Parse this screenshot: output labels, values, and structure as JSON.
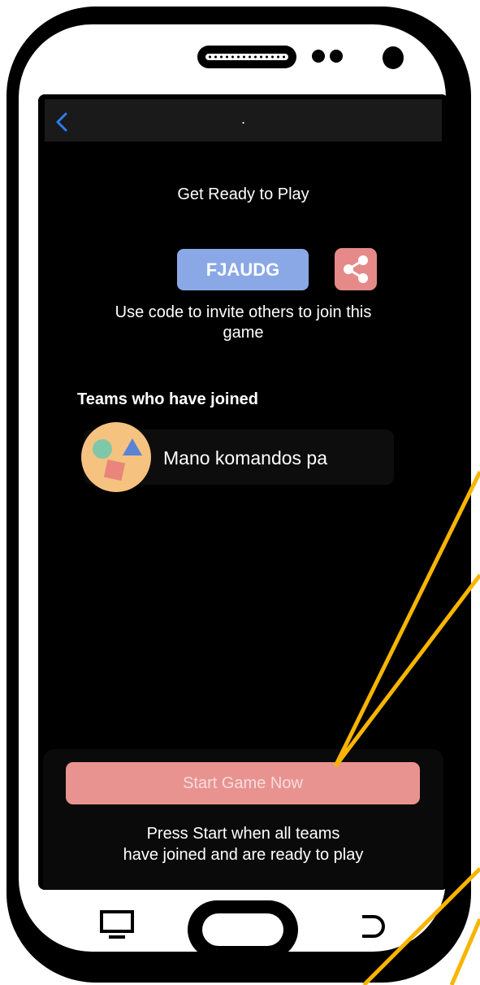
{
  "nav": {
    "title": "."
  },
  "main": {
    "heading": "Get Ready to Play",
    "game_code": "FJAUDG",
    "invite_text": "Use code to invite others to join this game",
    "teams_heading": "Teams who have joined",
    "teams": [
      {
        "name": "Mano komandos pa"
      }
    ]
  },
  "footer": {
    "start_label": "Start Game Now",
    "hint_line1": "Press Start when all teams",
    "hint_line2": "have joined and are ready to play"
  },
  "icons": {
    "back": "chevron-left-icon",
    "share": "share-icon",
    "team_avatar": "shapes-avatar-icon",
    "recent_apps": "recent-apps-icon",
    "home": "home-button",
    "back_hw": "back-arrow-icon"
  },
  "colors": {
    "accent_blue": "#2f7bf6",
    "code_button": "#8aa8e6",
    "share_button": "#e58a88",
    "start_button": "#e89390",
    "annotation_line": "#f7b500"
  }
}
